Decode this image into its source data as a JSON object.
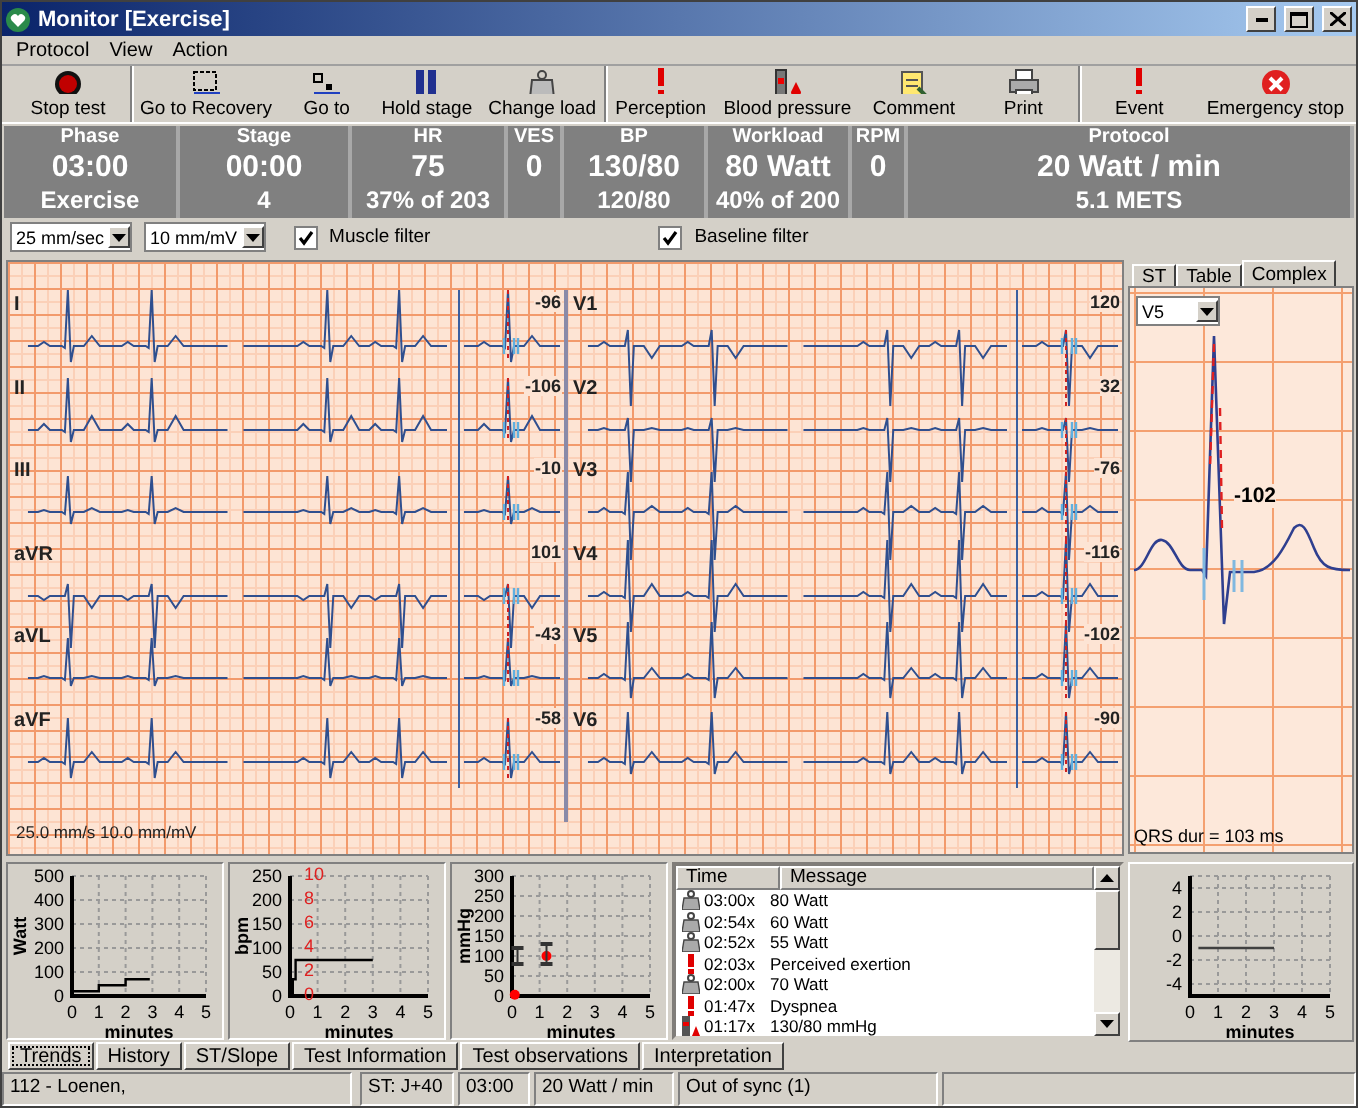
{
  "window": {
    "title": "Monitor [Exercise]"
  },
  "menu": [
    "Protocol",
    "View",
    "Action"
  ],
  "toolbar": {
    "groups": [
      [
        {
          "label": "Stop test",
          "kind": "record"
        }
      ],
      [
        {
          "label": "Go to Recovery",
          "kind": "recovery"
        },
        {
          "label": "Go to",
          "kind": "goto"
        },
        {
          "label": "Hold stage",
          "kind": "pause"
        },
        {
          "label": "Change load",
          "kind": "weight"
        }
      ],
      [
        {
          "label": "Perception",
          "kind": "alert"
        },
        {
          "label": "Blood pressure",
          "kind": "pressure"
        },
        {
          "label": "Comment",
          "kind": "comment"
        },
        {
          "label": "Print",
          "kind": "print"
        }
      ],
      [
        {
          "label": "Event",
          "kind": "alert"
        },
        {
          "label": "Emergency stop",
          "kind": "stop"
        }
      ]
    ]
  },
  "summary": [
    {
      "label": "Phase",
      "value": "03:00",
      "detail": "Exercise"
    },
    {
      "label": "Stage",
      "value": "00:00",
      "detail": "4"
    },
    {
      "label": "HR",
      "value": "75",
      "detail": "37% of 203"
    },
    {
      "label": "VES",
      "value": "0"
    },
    {
      "label": "BP",
      "value": "130/80",
      "detail": "120/80"
    },
    {
      "label": "Workload",
      "value": "80 Watt",
      "detail": "40% of 200"
    },
    {
      "label": "RPM",
      "value": "0"
    },
    {
      "label": "Protocol",
      "value": "20 Watt / min",
      "detail": "5.1 METS"
    }
  ],
  "options": {
    "speed": "25 mm/sec",
    "gain": "10 mm/mV",
    "filters": [
      {
        "label": "Muscle filter",
        "checked": true
      },
      {
        "label": "Baseline filter",
        "checked": true
      }
    ]
  },
  "ecg": {
    "columns": [
      [
        {
          "lead": "I",
          "value": "-96"
        },
        {
          "lead": "II",
          "value": "-106"
        },
        {
          "lead": "III",
          "value": "-10"
        },
        {
          "lead": "aVR",
          "value": "101"
        },
        {
          "lead": "aVL",
          "value": "-43"
        },
        {
          "lead": "aVF",
          "value": "-58"
        }
      ],
      [
        {
          "lead": "V1",
          "value": "120"
        },
        {
          "lead": "V2",
          "value": "32"
        },
        {
          "lead": "V3",
          "value": "-76"
        },
        {
          "lead": "V4",
          "value": "-116"
        },
        {
          "lead": "V5",
          "value": "-102"
        },
        {
          "lead": "V6",
          "value": "-90"
        }
      ]
    ],
    "scale": "25.0 mm/s 10.0 mm/mV"
  },
  "trends": [
    {
      "chart_data": {
        "type": "line",
        "xlabel": "minutes",
        "ylabel": "Watt",
        "grid": true,
        "xlim": [
          0,
          5
        ],
        "ylim": [
          0,
          500
        ],
        "xticks": [
          0,
          1,
          2,
          3,
          4,
          5
        ],
        "yticks": [
          0,
          100,
          200,
          300,
          400,
          500
        ],
        "x": [
          0,
          1,
          1,
          2,
          2,
          2.9
        ],
        "series": [
          {
            "color": "#000000",
            "values": [
              20,
              20,
              45,
              45,
              70,
              70
            ]
          }
        ]
      }
    },
    {
      "chart_data": {
        "type": "line",
        "xlabel": "minutes",
        "ylabel": "bpm",
        "grid": true,
        "xlim": [
          0,
          5
        ],
        "ylim": [
          0,
          250
        ],
        "xticks": [
          0,
          1,
          2,
          3,
          4,
          5
        ],
        "yticks": [
          0,
          50,
          100,
          150,
          200,
          250
        ],
        "x": [
          0.1,
          0.1,
          0.2,
          0.2,
          3
        ],
        "series": [
          {
            "color": "#000000",
            "values": [
              0,
              35,
              35,
              75,
              75
            ]
          }
        ]
      },
      "secondary_ticks": [
        "10",
        "8",
        "6",
        "4",
        "2",
        "0"
      ]
    },
    {
      "chart_data": {
        "type": "scatter",
        "xlabel": "minutes",
        "ylabel": "mmHg",
        "grid": true,
        "xlim": [
          0,
          5
        ],
        "ylim": [
          0,
          300
        ],
        "xticks": [
          0,
          1,
          2,
          3,
          4,
          5
        ],
        "yticks": [
          0,
          50,
          100,
          150,
          200,
          250,
          300
        ],
        "x": [
          0.1,
          0.2,
          1.25
        ],
        "series": [
          {
            "color": "#ff0000",
            "values": [
              3,
              null,
              100
            ]
          },
          {
            "color": "#333333",
            "values": [
              null,
              120,
              130
            ]
          },
          {
            "color": "#333333",
            "values": [
              null,
              80,
              80
            ]
          }
        ]
      }
    }
  ],
  "events": {
    "columns": [
      "Time",
      "Message"
    ],
    "rows": [
      {
        "kind": "load",
        "time": "03:00x",
        "message": "80 Watt"
      },
      {
        "kind": "load",
        "time": "02:54x",
        "message": "60 Watt"
      },
      {
        "kind": "load",
        "time": "02:52x",
        "message": "55 Watt"
      },
      {
        "kind": "event",
        "time": "02:03x",
        "message": "Perceived exertion"
      },
      {
        "kind": "load",
        "time": "02:00x",
        "message": "70 Watt"
      },
      {
        "kind": "event",
        "time": "01:47x",
        "message": "Dyspnea"
      },
      {
        "kind": "bp",
        "time": "01:17x",
        "message": "130/80 mmHg"
      }
    ]
  },
  "side_panel": {
    "tabs": [
      {
        "label": "ST",
        "selected": false
      },
      {
        "label": "Table",
        "selected": false
      },
      {
        "label": "Complex",
        "selected": true
      }
    ],
    "lead": "V5",
    "value": "-102",
    "qrs": "QRS dur = 103 ms",
    "chart": {
      "chart_data": {
        "type": "line",
        "xlabel": "minutes",
        "grid": true,
        "xlim": [
          0,
          5
        ],
        "ylim": [
          -5,
          5
        ],
        "xticks": [
          0,
          1,
          2,
          3,
          4,
          5
        ],
        "yticks": [
          -4,
          -2,
          0,
          2,
          4
        ],
        "x": [
          0.3,
          3
        ],
        "series": [
          {
            "color": "#404040",
            "values": [
              -1,
              -1
            ]
          }
        ]
      }
    }
  },
  "bottom_tabs": [
    {
      "label": "Trends",
      "selected": true
    },
    {
      "label": "History",
      "selected": false
    },
    {
      "label": "ST/Slope",
      "selected": false
    },
    {
      "label": "Test Information",
      "selected": false
    },
    {
      "label": "Test observations",
      "selected": false
    },
    {
      "label": "Interpretation",
      "selected": false
    }
  ],
  "status_bar": [
    "112 - Loenen,",
    "ST: J+40",
    "03:00",
    "20 Watt / min",
    "Out of sync (1)"
  ]
}
